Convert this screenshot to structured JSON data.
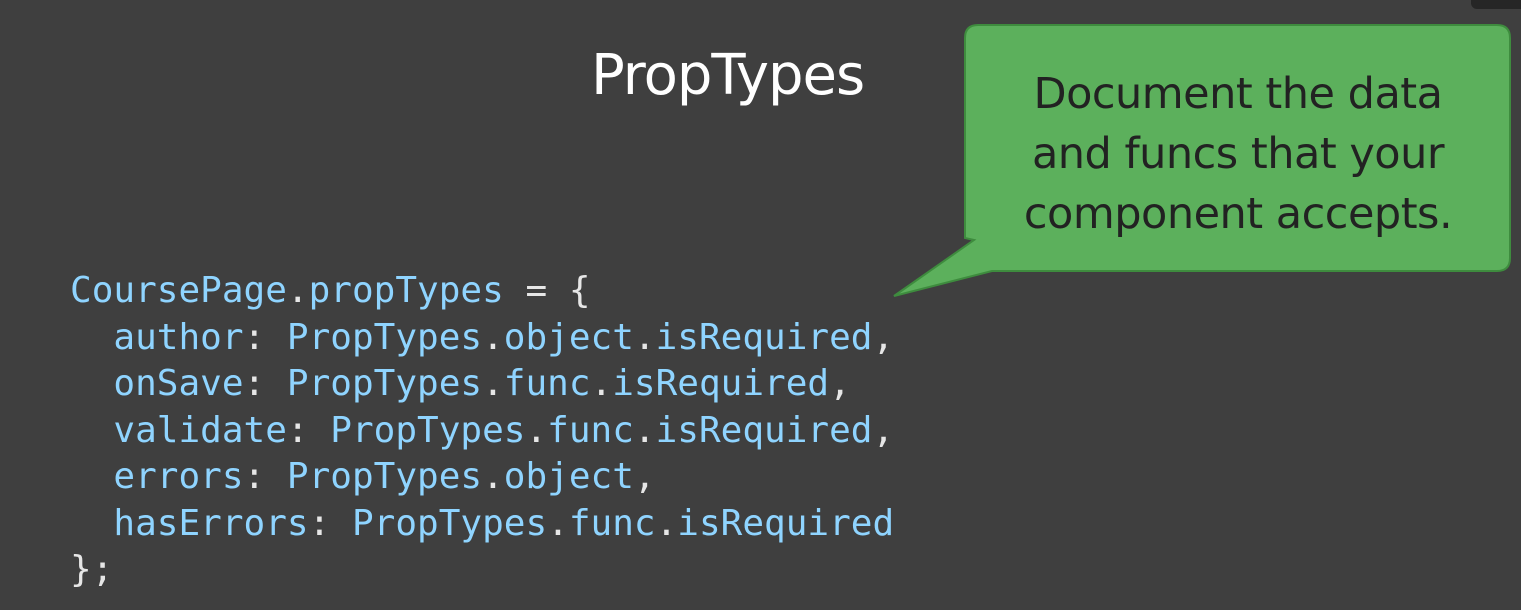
{
  "slide": {
    "title": "PropTypes"
  },
  "callout": {
    "text": "Document the data\nand funcs that your\ncomponent accepts.",
    "color": "#5cb05c",
    "border_color": "#3e8c3e"
  },
  "code": {
    "text_color": "#8fd4ff",
    "lines": [
      "CoursePage.propTypes = {",
      "  author: PropTypes.object.isRequired,",
      "  onSave: PropTypes.func.isRequired,",
      "  validate: PropTypes.func.isRequired,",
      "  errors: PropTypes.object,",
      "  hasErrors: PropTypes.func.isRequired",
      "};"
    ]
  },
  "background_color": "#3f3f3f"
}
